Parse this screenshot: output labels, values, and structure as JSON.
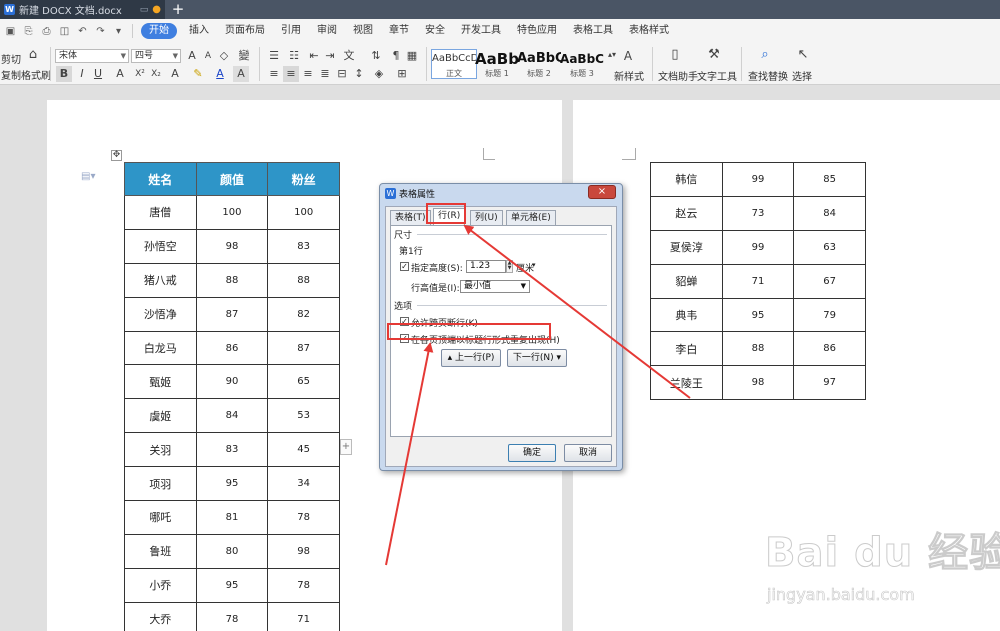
{
  "title_bar": {
    "doc_tab_title": "新建 DOCX 文档.docx",
    "new_tab_icon": "+"
  },
  "menu": {
    "items": [
      "开始",
      "插入",
      "页面布局",
      "引用",
      "审阅",
      "视图",
      "章节",
      "安全",
      "开发工具",
      "特色应用",
      "表格工具",
      "表格样式"
    ],
    "active": "开始"
  },
  "ribbon": {
    "cut": "剪切",
    "copy": "复制",
    "format_painter": "格式刷",
    "font_name": "宋体",
    "font_size": "四号",
    "styles": [
      {
        "sample": "AaBbCcDd",
        "name": "正文"
      },
      {
        "sample": "AaBb",
        "name": "标题 1"
      },
      {
        "sample": "AaBbC",
        "name": "标题 2"
      },
      {
        "sample": "AaBbC",
        "name": "标题 3"
      }
    ],
    "new_style": "新样式",
    "doc_assistant": "文档助手",
    "text_tools": "文字工具",
    "find_replace": "查找替换",
    "select": "选择"
  },
  "table_left": {
    "headers": [
      "姓名",
      "颜值",
      "粉丝"
    ],
    "rows": [
      [
        "唐僧",
        "100",
        "100"
      ],
      [
        "孙悟空",
        "98",
        "83"
      ],
      [
        "猪八戒",
        "88",
        "88"
      ],
      [
        "沙悟净",
        "87",
        "82"
      ],
      [
        "白龙马",
        "86",
        "87"
      ],
      [
        "甄姬",
        "90",
        "65"
      ],
      [
        "虞姬",
        "84",
        "53"
      ],
      [
        "关羽",
        "83",
        "45"
      ],
      [
        "项羽",
        "95",
        "34"
      ],
      [
        "哪吒",
        "81",
        "78"
      ],
      [
        "鲁班",
        "80",
        "98"
      ],
      [
        "小乔",
        "95",
        "78"
      ],
      [
        "大乔",
        "78",
        "71"
      ]
    ]
  },
  "table_right": {
    "rows": [
      [
        "韩信",
        "99",
        "85"
      ],
      [
        "赵云",
        "73",
        "84"
      ],
      [
        "夏侯淳",
        "99",
        "63"
      ],
      [
        "貂蝉",
        "71",
        "67"
      ],
      [
        "典韦",
        "95",
        "79"
      ],
      [
        "李白",
        "88",
        "86"
      ],
      [
        "兰陵王",
        "98",
        "97"
      ]
    ]
  },
  "dialog": {
    "title": "表格属性",
    "close_label": "×",
    "tabs": [
      "表格(T)",
      "行(R)",
      "列(U)",
      "单元格(E)"
    ],
    "selected_tab": "行(R)",
    "size_section": "尺寸",
    "row_label": "第1行",
    "specify_height_label": "指定高度(S):",
    "height_value": "1.23",
    "height_unit": "厘米",
    "row_height_label": "行高值是(I):",
    "row_height_mode": "最小值",
    "options_section": "选项",
    "allow_break_label": "允许跨页断行(K)",
    "repeat_header_label": "在各页顶端以标题行形式重复出现(H)",
    "prev_row_button": "上一行(P)",
    "next_row_button": "下一行(N)",
    "ok_button": "确定",
    "cancel_button": "取消"
  },
  "watermark": {
    "logo": "Bai du 经验",
    "url": "jingyan.baidu.com"
  },
  "colors": {
    "header_fill": "#2e95c8",
    "active_menu": "#3f7fe0",
    "highlight_red": "#e53935"
  }
}
